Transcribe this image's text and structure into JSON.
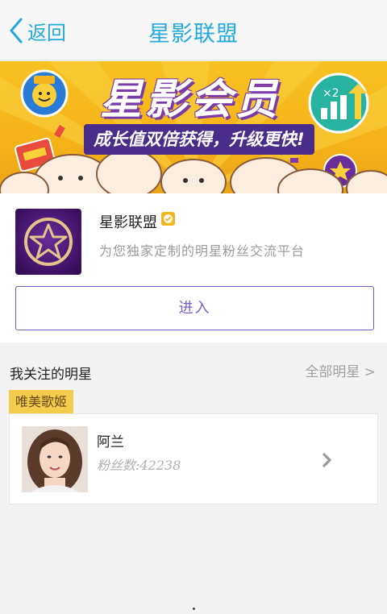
{
  "nav": {
    "back_label": "返回",
    "title": "星影联盟"
  },
  "banner": {
    "title": "星影会员",
    "subtitle": "成长值双倍获得，升级更快!",
    "badge_text": "×2"
  },
  "app": {
    "name": "星影联盟",
    "description": "为您独家定制的明星粉丝交流平台",
    "enter_label": "进入"
  },
  "follow": {
    "title": "我关注的明星",
    "all_label": "全部明星 >",
    "tag": "唯美歌姬",
    "stars": [
      {
        "name": "阿兰",
        "fans_label": "粉丝数:42238"
      }
    ]
  },
  "colors": {
    "accent": "#23a9dd",
    "purple": "#7a5cc4",
    "tag_bg": "#f3cb4d"
  }
}
